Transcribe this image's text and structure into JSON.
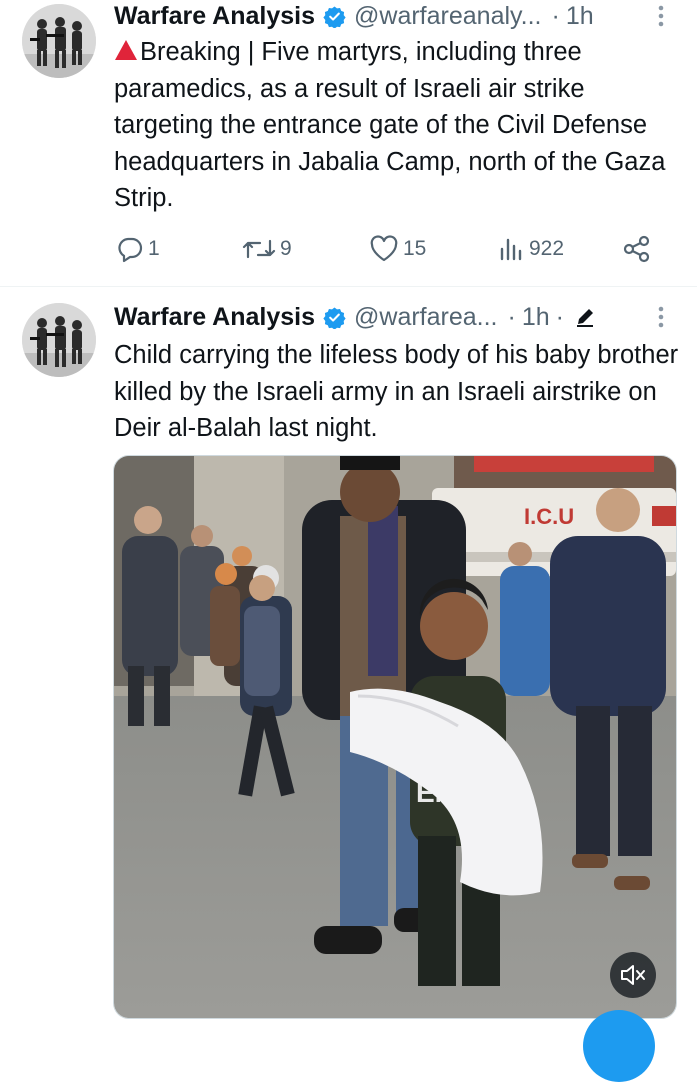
{
  "tweets": [
    {
      "author_name": "Warfare Analysis",
      "handle": "@warfareanaly...",
      "separator": "·",
      "time": "1h",
      "text": "Breaking | Five martyrs, including three paramedics, as a result of Israeli air strike targeting the entrance gate of the Civil Defense headquarters in Jabalia Camp, north of the Gaza Strip.",
      "prefix_icon": "red-triangle-icon",
      "replies": "1",
      "reposts": "9",
      "likes": "15",
      "views": "922"
    },
    {
      "author_name": "Warfare Analysis",
      "handle": "@warfarea...",
      "separator": "·",
      "time": "1h",
      "time_separator": "·",
      "text": "Child carrying the lifeless body of his baby brother killed by the Israeli army in an Israeli airstrike on Deir al-Balah last night.",
      "media": {
        "ambulance_text": "I.C.U",
        "shirt_text": "ENIM",
        "mute_icon": "speaker-muted-icon"
      }
    }
  ],
  "colors": {
    "verified": "#1d9bf0",
    "secondary_text": "#536471",
    "alert_red": "#e0243a",
    "accent": "#1d9bf0"
  }
}
